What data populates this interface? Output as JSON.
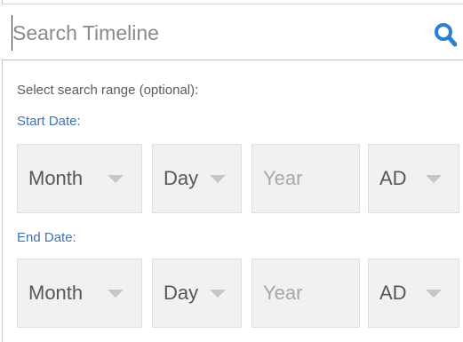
{
  "search": {
    "placeholder": "Search Timeline",
    "icon": "search-icon",
    "icon_color": "#2a7fd6"
  },
  "range": {
    "label": "Select search range (optional):"
  },
  "start_date": {
    "label": "Start Date:",
    "month": "Month",
    "day": "Day",
    "year_placeholder": "Year",
    "era": "AD"
  },
  "end_date": {
    "label": "End Date:",
    "month": "Month",
    "day": "Day",
    "year_placeholder": "Year",
    "era": "AD"
  },
  "colors": {
    "label_accent": "#3f73b2",
    "field_background": "#f1f1f1"
  }
}
